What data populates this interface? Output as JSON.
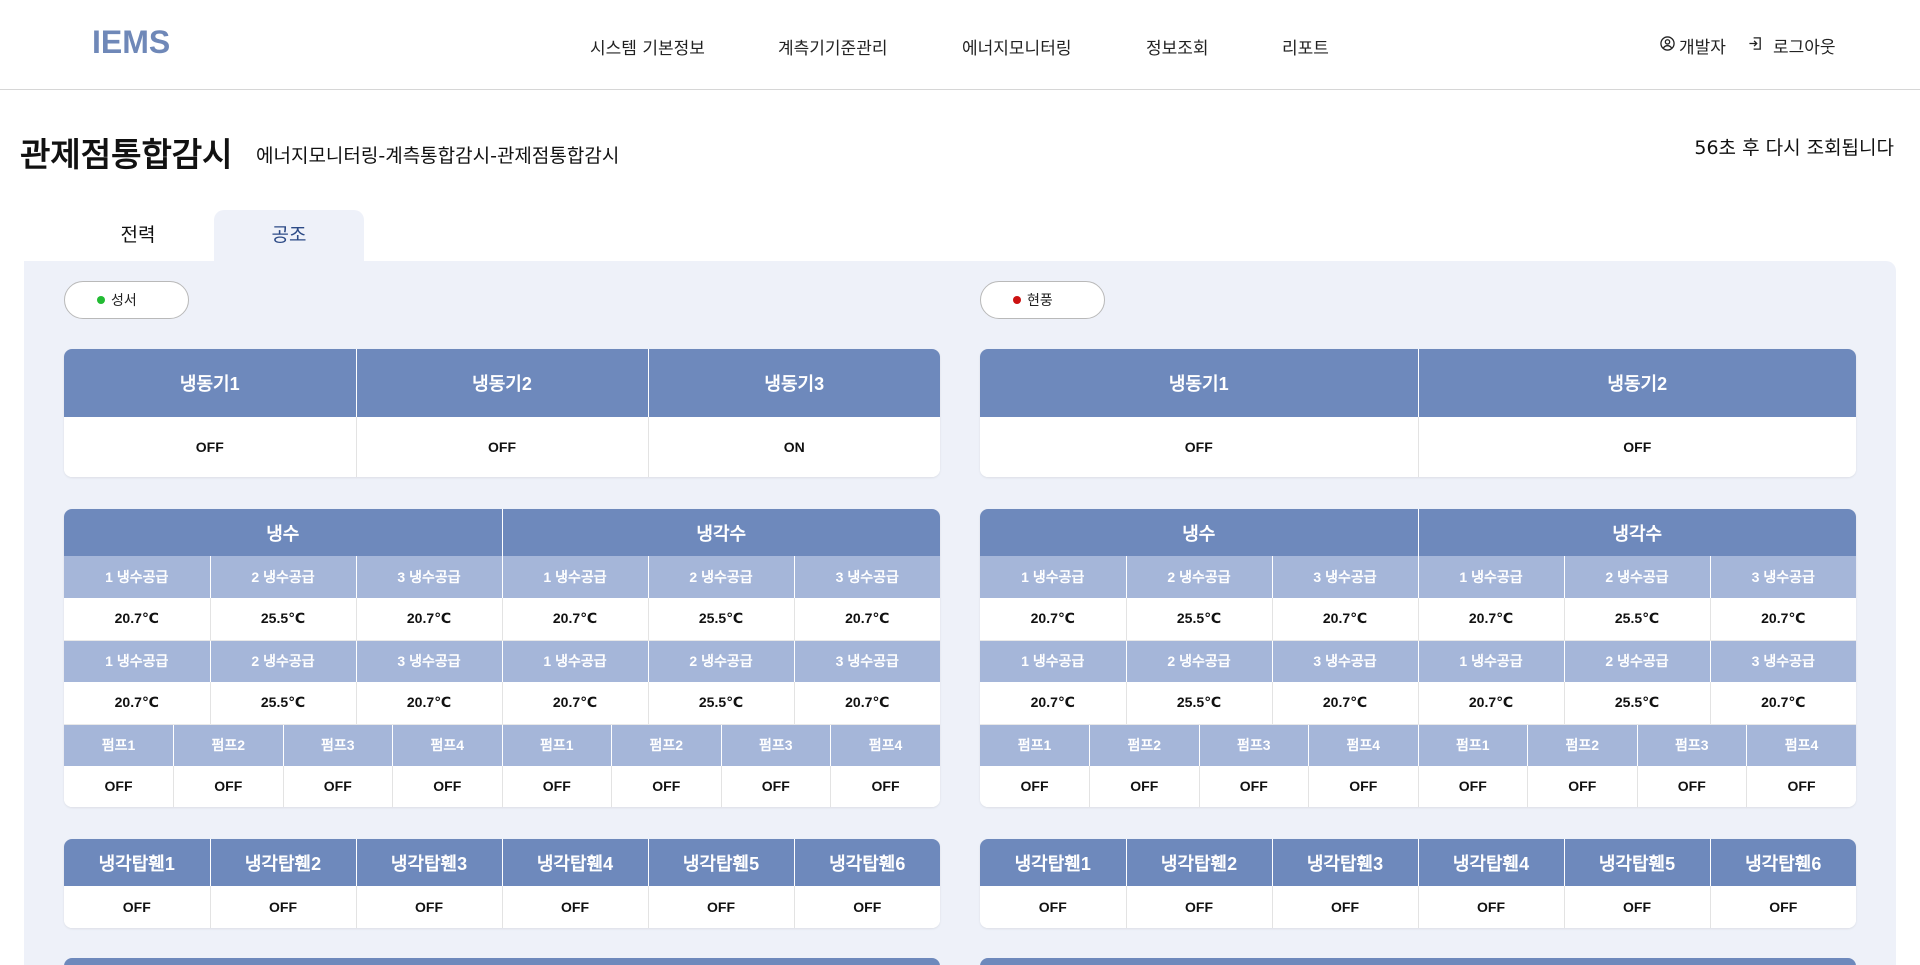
{
  "header": {
    "logo": "IEMS",
    "nav": [
      "시스템 기본정보",
      "계측기기준관리",
      "에너지모니터링",
      "정보조회",
      "리포트"
    ],
    "user_label": "개발자",
    "logout_label": "로그아웃"
  },
  "page": {
    "title": "관제점통합감시",
    "breadcrumb": "에너지모니터링-계측통합감시-관제점통합감시",
    "refresh_note": "56초 후 다시 조회됩니다"
  },
  "tabs": [
    {
      "label": "전력",
      "active": false
    },
    {
      "label": "공조",
      "active": true
    }
  ],
  "colors": {
    "header_dark": "#6e89bc",
    "header_light": "#a5b6d9",
    "panel_bg": "#eef1f9",
    "status_ok": "#22bb33",
    "status_alarm": "#cc1111"
  },
  "sites": [
    {
      "name": "성서",
      "status_color": "#22bb33",
      "chillers": {
        "headers": [
          "냉동기1",
          "냉동기2",
          "냉동기3"
        ],
        "values": [
          "OFF",
          "OFF",
          "ON"
        ]
      },
      "water": {
        "groups": [
          "냉수",
          "냉각수"
        ],
        "rows": [
          {
            "labels": [
              "1 냉수공급",
              "2 냉수공급",
              "3 냉수공급",
              "1 냉수공급",
              "2 냉수공급",
              "3 냉수공급"
            ],
            "values": [
              "20.7℃",
              "25.5℃",
              "20.7℃",
              "20.7℃",
              "25.5℃",
              "20.7℃"
            ]
          },
          {
            "labels": [
              "1 냉수공급",
              "2 냉수공급",
              "3 냉수공급",
              "1 냉수공급",
              "2 냉수공급",
              "3 냉수공급"
            ],
            "values": [
              "20.7℃",
              "25.5℃",
              "20.7℃",
              "20.7℃",
              "25.5℃",
              "20.7℃"
            ]
          }
        ],
        "pumps": {
          "labels": [
            "펌프1",
            "펌프2",
            "펌프3",
            "펌프4",
            "펌프1",
            "펌프2",
            "펌프3",
            "펌프4"
          ],
          "values": [
            "OFF",
            "OFF",
            "OFF",
            "OFF",
            "OFF",
            "OFF",
            "OFF",
            "OFF"
          ]
        }
      },
      "towers": {
        "headers": [
          "냉각탑휀1",
          "냉각탑휀2",
          "냉각탑휀3",
          "냉각탑휀4",
          "냉각탑휀5",
          "냉각탑휀6"
        ],
        "values": [
          "OFF",
          "OFF",
          "OFF",
          "OFF",
          "OFF",
          "OFF"
        ]
      }
    },
    {
      "name": "현풍",
      "status_color": "#cc1111",
      "chillers": {
        "headers": [
          "냉동기1",
          "냉동기2"
        ],
        "values": [
          "OFF",
          "OFF"
        ]
      },
      "water": {
        "groups": [
          "냉수",
          "냉각수"
        ],
        "rows": [
          {
            "labels": [
              "1 냉수공급",
              "2 냉수공급",
              "3 냉수공급",
              "1 냉수공급",
              "2 냉수공급",
              "3 냉수공급"
            ],
            "values": [
              "20.7℃",
              "25.5℃",
              "20.7℃",
              "20.7℃",
              "25.5℃",
              "20.7℃"
            ]
          },
          {
            "labels": [
              "1 냉수공급",
              "2 냉수공급",
              "3 냉수공급",
              "1 냉수공급",
              "2 냉수공급",
              "3 냉수공급"
            ],
            "values": [
              "20.7℃",
              "25.5℃",
              "20.7℃",
              "20.7℃",
              "25.5℃",
              "20.7℃"
            ]
          }
        ],
        "pumps": {
          "labels": [
            "펌프1",
            "펌프2",
            "펌프3",
            "펌프4",
            "펌프1",
            "펌프2",
            "펌프3",
            "펌프4"
          ],
          "values": [
            "OFF",
            "OFF",
            "OFF",
            "OFF",
            "OFF",
            "OFF",
            "OFF",
            "OFF"
          ]
        }
      },
      "towers": {
        "headers": [
          "냉각탑휀1",
          "냉각탑휀2",
          "냉각탑휀3",
          "냉각탑휀4",
          "냉각탑휀5",
          "냉각탑휀6"
        ],
        "values": [
          "OFF",
          "OFF",
          "OFF",
          "OFF",
          "OFF",
          "OFF"
        ]
      }
    }
  ]
}
